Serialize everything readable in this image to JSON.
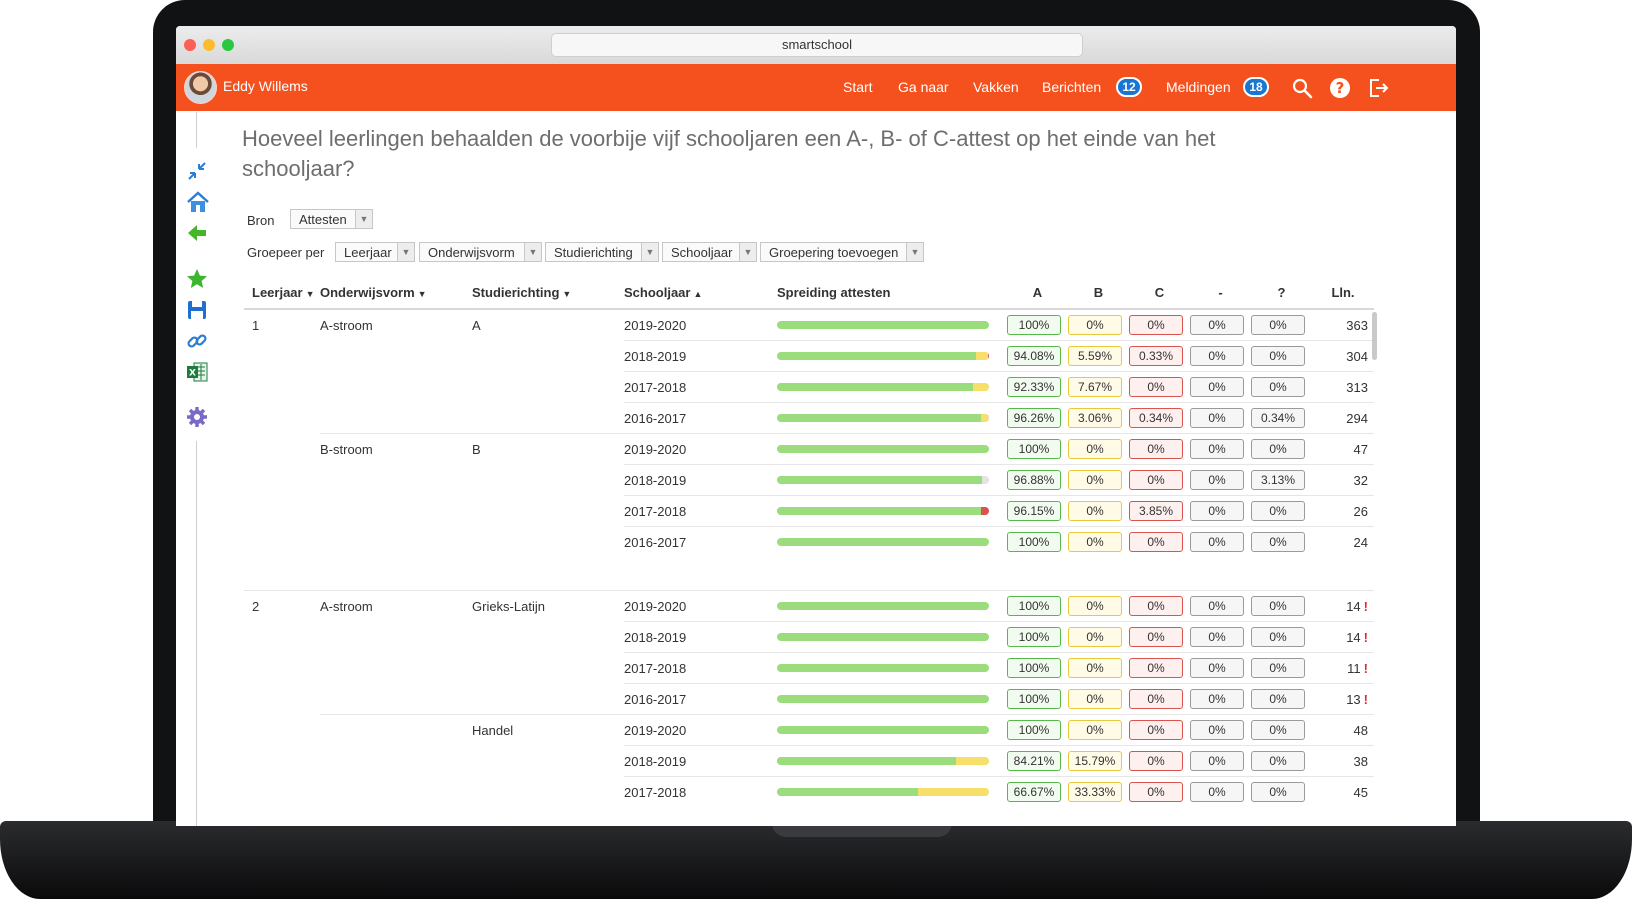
{
  "browser": {
    "url": "smartschool"
  },
  "header": {
    "user_name": "Eddy Willems",
    "nav": [
      "Start",
      "Ga naar",
      "Vakken",
      "Berichten",
      "Meldingen"
    ],
    "berichten_count": "12",
    "meldingen_count": "18"
  },
  "page": {
    "title": "Hoeveel leerlingen behaalden de voorbije vijf schooljaren een A-, B- of C-attest op het einde van het schooljaar?",
    "source_label": "Bron",
    "source_value": "Attesten",
    "group_label": "Groepeer per",
    "group_filters": [
      "Leerjaar",
      "Onderwijsvorm",
      "Studierichting",
      "Schooljaar",
      "Groepering toevoegen"
    ]
  },
  "table": {
    "headers": [
      "Leerjaar",
      "Onderwijsvorm",
      "Studierichting",
      "Schooljaar",
      "Spreiding attesten",
      "A",
      "B",
      "C",
      "-",
      "?",
      "Lln."
    ],
    "rows": [
      {
        "leerjaar": "1",
        "vorm": "A-stroom",
        "richting": "A",
        "jaar": "2019-2020",
        "A": "100%",
        "B": "0%",
        "C": "0%",
        "N": "0%",
        "Q": "0%",
        "lln": "363",
        "warn": false,
        "dist": [
          100,
          0,
          0,
          0,
          0
        ]
      },
      {
        "leerjaar": "",
        "vorm": "",
        "richting": "",
        "jaar": "2018-2019",
        "A": "94.08%",
        "B": "5.59%",
        "C": "0.33%",
        "N": "0%",
        "Q": "0%",
        "lln": "304",
        "warn": false,
        "dist": [
          94.08,
          5.59,
          0.33,
          0,
          0
        ]
      },
      {
        "leerjaar": "",
        "vorm": "",
        "richting": "",
        "jaar": "2017-2018",
        "A": "92.33%",
        "B": "7.67%",
        "C": "0%",
        "N": "0%",
        "Q": "0%",
        "lln": "313",
        "warn": false,
        "dist": [
          92.33,
          7.67,
          0,
          0,
          0
        ]
      },
      {
        "leerjaar": "",
        "vorm": "",
        "richting": "",
        "jaar": "2016-2017",
        "A": "96.26%",
        "B": "3.06%",
        "C": "0.34%",
        "N": "0%",
        "Q": "0.34%",
        "lln": "294",
        "warn": false,
        "dist": [
          96.26,
          3.06,
          0.34,
          0,
          0.34
        ]
      },
      {
        "leerjaar": "",
        "vorm": "B-stroom",
        "richting": "B",
        "jaar": "2019-2020",
        "A": "100%",
        "B": "0%",
        "C": "0%",
        "N": "0%",
        "Q": "0%",
        "lln": "47",
        "warn": false,
        "dist": [
          100,
          0,
          0,
          0,
          0
        ],
        "sep": true
      },
      {
        "leerjaar": "",
        "vorm": "",
        "richting": "",
        "jaar": "2018-2019",
        "A": "96.88%",
        "B": "0%",
        "C": "0%",
        "N": "0%",
        "Q": "3.13%",
        "lln": "32",
        "warn": false,
        "dist": [
          96.88,
          0,
          0,
          0,
          3.13
        ]
      },
      {
        "leerjaar": "",
        "vorm": "",
        "richting": "",
        "jaar": "2017-2018",
        "A": "96.15%",
        "B": "0%",
        "C": "3.85%",
        "N": "0%",
        "Q": "0%",
        "lln": "26",
        "warn": false,
        "dist": [
          96.15,
          0,
          3.85,
          0,
          0
        ]
      },
      {
        "leerjaar": "",
        "vorm": "",
        "richting": "",
        "jaar": "2016-2017",
        "A": "100%",
        "B": "0%",
        "C": "0%",
        "N": "0%",
        "Q": "0%",
        "lln": "24",
        "warn": false,
        "dist": [
          100,
          0,
          0,
          0,
          0
        ]
      },
      {
        "leerjaar": "2",
        "vorm": "A-stroom",
        "richting": "Grieks-Latijn",
        "jaar": "2019-2020",
        "A": "100%",
        "B": "0%",
        "C": "0%",
        "N": "0%",
        "Q": "0%",
        "lln": "14",
        "warn": true,
        "dist": [
          100,
          0,
          0,
          0,
          0
        ],
        "group": true
      },
      {
        "leerjaar": "",
        "vorm": "",
        "richting": "",
        "jaar": "2018-2019",
        "A": "100%",
        "B": "0%",
        "C": "0%",
        "N": "0%",
        "Q": "0%",
        "lln": "14",
        "warn": true,
        "dist": [
          100,
          0,
          0,
          0,
          0
        ]
      },
      {
        "leerjaar": "",
        "vorm": "",
        "richting": "",
        "jaar": "2017-2018",
        "A": "100%",
        "B": "0%",
        "C": "0%",
        "N": "0%",
        "Q": "0%",
        "lln": "11",
        "warn": true,
        "dist": [
          100,
          0,
          0,
          0,
          0
        ]
      },
      {
        "leerjaar": "",
        "vorm": "",
        "richting": "",
        "jaar": "2016-2017",
        "A": "100%",
        "B": "0%",
        "C": "0%",
        "N": "0%",
        "Q": "0%",
        "lln": "13",
        "warn": true,
        "dist": [
          100,
          0,
          0,
          0,
          0
        ]
      },
      {
        "leerjaar": "",
        "vorm": "",
        "richting": "Handel",
        "jaar": "2019-2020",
        "A": "100%",
        "B": "0%",
        "C": "0%",
        "N": "0%",
        "Q": "0%",
        "lln": "48",
        "warn": false,
        "dist": [
          100,
          0,
          0,
          0,
          0
        ],
        "sep": true
      },
      {
        "leerjaar": "",
        "vorm": "",
        "richting": "",
        "jaar": "2018-2019",
        "A": "84.21%",
        "B": "15.79%",
        "C": "0%",
        "N": "0%",
        "Q": "0%",
        "lln": "38",
        "warn": false,
        "dist": [
          84.21,
          15.79,
          0,
          0,
          0
        ]
      },
      {
        "leerjaar": "",
        "vorm": "",
        "richting": "",
        "jaar": "2017-2018",
        "A": "66.67%",
        "B": "33.33%",
        "C": "0%",
        "N": "0%",
        "Q": "0%",
        "lln": "45",
        "warn": false,
        "dist": [
          66.67,
          33.33,
          0,
          0,
          0
        ]
      }
    ],
    "warn_mark": "!"
  },
  "colors": {
    "accent": "#f4511e",
    "badge": "#1976d2",
    "bar_a": "#9bdc7c",
    "bar_b": "#f6df6a",
    "bar_c": "#d9534f",
    "bar_q": "#e3e3e3"
  },
  "icons": [
    "collapse-icon",
    "home-icon",
    "back-arrow-icon",
    "star-icon",
    "save-icon",
    "link-icon",
    "excel-icon",
    "gear-icon",
    "search-icon",
    "help-icon",
    "logout-icon"
  ]
}
